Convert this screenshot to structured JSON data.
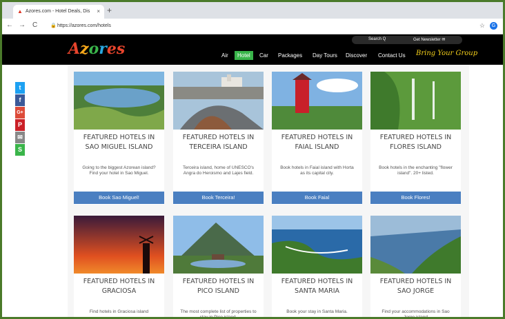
{
  "browser": {
    "tab_title": "Azores.com - Hotel Deals, Dis",
    "tab_close": "×",
    "new_tab": "+",
    "back": "←",
    "forward": "→",
    "reload": "C",
    "url": "https://azores.com/hotels",
    "profile_initial": "G"
  },
  "site": {
    "logo": [
      "A",
      "z",
      "o",
      "r",
      "es"
    ],
    "search_label": "Search Q",
    "newsletter_label": "Get Newsletter ✉",
    "nav": [
      "Air",
      "Hotel",
      "Car",
      "Packages",
      "Day Tours",
      "Discover",
      "Contact Us"
    ],
    "active_nav": "Hotel",
    "bring_group": "Bring Your Group",
    "accent_color": "#39b54a",
    "button_color": "#4a7fc1"
  },
  "share": [
    {
      "icon": "twitter-icon",
      "glyph": "t",
      "color": "#1da1f2"
    },
    {
      "icon": "facebook-icon",
      "glyph": "f",
      "color": "#3b5998"
    },
    {
      "icon": "google-plus-icon",
      "glyph": "G+",
      "color": "#dd4b39"
    },
    {
      "icon": "pinterest-icon",
      "glyph": "P",
      "color": "#cb2027"
    },
    {
      "icon": "email-icon",
      "glyph": "✉",
      "color": "#888888"
    },
    {
      "icon": "share-icon",
      "glyph": "S",
      "color": "#3ab54a"
    }
  ],
  "cards": [
    {
      "title1": "FEATURED HOTELS IN",
      "title2": "SAO MIGUEL ISLAND",
      "desc": "Going to the biggest Azorean island? Find your hotel in Sao Miguel.",
      "button": "Book Sao Miguel!"
    },
    {
      "title1": "FEATURED HOTELS IN",
      "title2": "TERCEIRA ISLAND",
      "desc": "Terceira island, home of UNESCO's Angra do Heroismo and Lajes field.",
      "button": "Book Terceira!"
    },
    {
      "title1": "FEATURED HOTELS IN",
      "title2": "FAIAL ISLAND",
      "desc": "Book hotels in Faial island with Horta as its capital city.",
      "button": "Book Faial"
    },
    {
      "title1": "FEATURED HOTELS IN",
      "title2": "FLORES ISLAND",
      "desc": "Book hotels in the enchanting \"flower island\". 20+ listed.",
      "button": "Book Flores!"
    },
    {
      "title1": "FEATURED HOTELS IN",
      "title2": "GRACIOSA",
      "desc": "Find hotels in Graciosa island",
      "button": ""
    },
    {
      "title1": "FEATURED HOTELS IN",
      "title2": "PICO ISLAND",
      "desc": "The most complete list of properties to stay in Pico island.",
      "button": ""
    },
    {
      "title1": "FEATURED HOTELS IN",
      "title2": "SANTA MARIA",
      "desc": "Book your stay in Santa Maria.",
      "button": ""
    },
    {
      "title1": "FEATURED HOTELS IN",
      "title2": "SAO JORGE",
      "desc": "Find your accommodations in Sao Jorge island",
      "button": ""
    }
  ]
}
